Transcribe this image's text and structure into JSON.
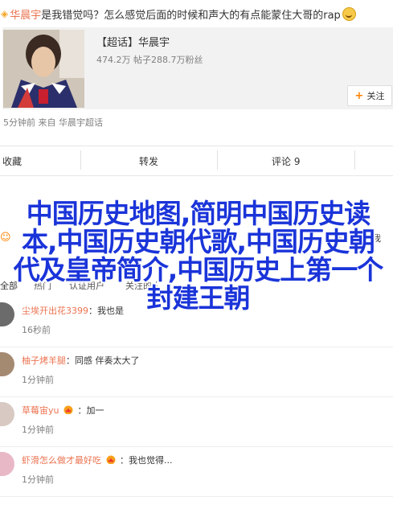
{
  "post": {
    "author": "华晨宇",
    "title_text": "是我错觉吗？怎么感觉后面的时候和声大的有点能蒙住大哥的rap",
    "time": "5分钟前",
    "source_prefix": "来自",
    "source": "华晨宇超话"
  },
  "topic_card": {
    "name": "【超话】华晨宇",
    "stats": "474.2万 帖子288.7万粉丝",
    "follow_label": "关注"
  },
  "actions": {
    "favorite": "收藏",
    "repost": "转发",
    "comment": "评论 9"
  },
  "repost_check": "时转发到我",
  "overlay_title": "中国历史地图,简明中国历史读本,中国历史朝代歌,中国历史朝代及皇帝简介,中国历史上第一个封建王朝",
  "comments_header": {
    "all": "全部",
    "hot": "热门",
    "followed": "认证用户",
    "mentioned": "关注的人"
  },
  "comments": [
    {
      "user": "尘埃开出花3399",
      "text": "我也是",
      "time": "16秒前",
      "crown": false
    },
    {
      "user": "柚子烤羊腿",
      "text": "同感 伴奏太大了",
      "time": "1分钟前",
      "crown": false
    },
    {
      "user": "草莓宙yu",
      "text": "加一",
      "time": "1分钟前",
      "crown": true
    },
    {
      "user": "虾滑怎么做才最好吃",
      "text": "我也觉得...",
      "time": "1分钟前",
      "crown": true
    }
  ],
  "colors": {
    "username": "#eb7350",
    "overlay": "#1a34d9",
    "accent": "#ff8200"
  }
}
